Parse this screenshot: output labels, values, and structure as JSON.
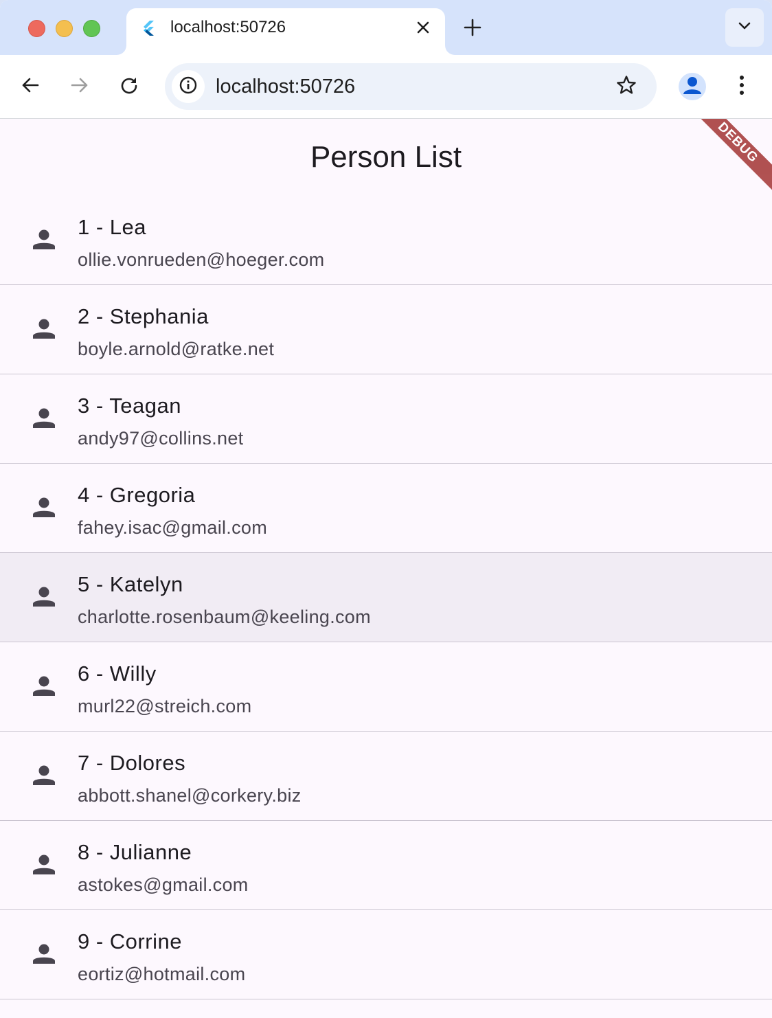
{
  "browser": {
    "tab": {
      "title": "localhost:50726"
    },
    "address_bar": {
      "url": "localhost:50726"
    }
  },
  "app": {
    "title": "Person List",
    "debug_banner": "DEBUG",
    "people": [
      {
        "title": "1 - Lea",
        "email": "ollie.vonrueden@hoeger.com"
      },
      {
        "title": "2 - Stephania",
        "email": "boyle.arnold@ratke.net"
      },
      {
        "title": "3 - Teagan",
        "email": "andy97@collins.net"
      },
      {
        "title": "4 - Gregoria",
        "email": "fahey.isac@gmail.com"
      },
      {
        "title": "5 - Katelyn",
        "email": "charlotte.rosenbaum@keeling.com"
      },
      {
        "title": "6 - Willy",
        "email": "murl22@streich.com"
      },
      {
        "title": "7 - Dolores",
        "email": "abbott.shanel@corkery.biz"
      },
      {
        "title": "8 - Julianne",
        "email": "astokes@gmail.com"
      },
      {
        "title": "9 - Corrine",
        "email": "eortiz@hotmail.com"
      }
    ],
    "hovered_index": 4
  },
  "icons": {
    "row_icon": "person-icon",
    "tab_favicon": "flutter-icon",
    "tab_close": "close-icon",
    "new_tab": "plus-icon",
    "tab_search": "chevron-down-icon",
    "back": "arrow-left-icon",
    "forward": "arrow-right-icon",
    "reload": "reload-icon",
    "site_info": "info-icon",
    "bookmark": "star-icon",
    "profile": "avatar-icon",
    "menu": "more-vert-icon"
  },
  "colors": {
    "tabstrip": "#d6e3fb",
    "omnibox": "#edf2fa",
    "page_background": "#fdf8fe",
    "hover_row": "#f1ecf4",
    "divider": "#cac4d0",
    "debug_banner": "#a83f3f"
  }
}
